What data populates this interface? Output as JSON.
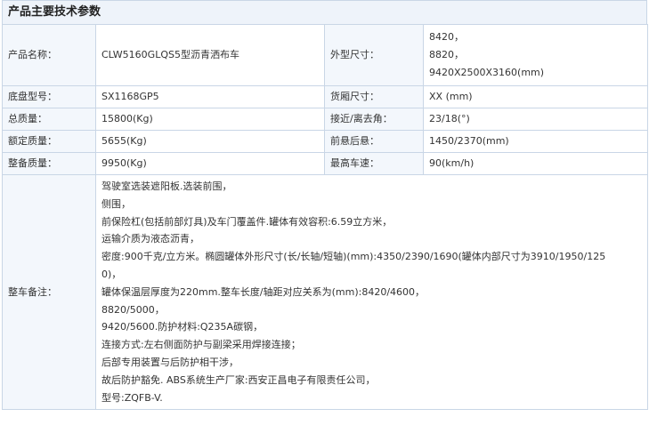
{
  "section_title": "产品主要技术参数",
  "rows": [
    {
      "label1": "产品名称：",
      "value1": "CLW5160GLQS5型沥青洒布车",
      "label2": "外型尺寸：",
      "value2_lines": [
        "8420，",
        "8820，",
        "9420X2500X3160(mm)"
      ]
    },
    {
      "label1": "底盘型号：",
      "value1": "SX1168GP5",
      "label2": "货厢尺寸：",
      "value2": "XX (mm)"
    },
    {
      "label1": "总质量：",
      "value1": "15800(Kg)",
      "label2": "接近/离去角：",
      "value2": "23/18(°)"
    },
    {
      "label1": "额定质量：",
      "value1": "5655(Kg)",
      "label2": "前悬后悬：",
      "value2": "1450/2370(mm)"
    },
    {
      "label1": "整备质量：",
      "value1": "9950(Kg)",
      "label2": "最高车速：",
      "value2": "90(km/h)"
    }
  ],
  "notes": {
    "label": "整车备注：",
    "lines": [
      "驾驶室选装遮阳板.选装前围，",
      "侧围，",
      "前保险杠(包括前部灯具)及车门覆盖件.罐体有效容积:6.59立方米，",
      "运输介质为液态沥青，",
      "密度:900千克/立方米。椭圆罐体外形尺寸(长/长轴/短轴)(mm):4350/2390/1690(罐体内部尺寸为3910/1950/125",
      "0)，",
      "罐体保温层厚度为220mm.整车长度/轴距对应关系为(mm):8420/4600，",
      "8820/5000，",
      "9420/5600.防护材料:Q235A碳钢，",
      "连接方式:左右侧面防护与副梁采用焊接连接；",
      "后部专用装置与后防护相干涉，",
      "故后防护豁免. ABS系统生产厂家:西安正昌电子有限责任公司，",
      "型号:ZQFB-V."
    ]
  }
}
